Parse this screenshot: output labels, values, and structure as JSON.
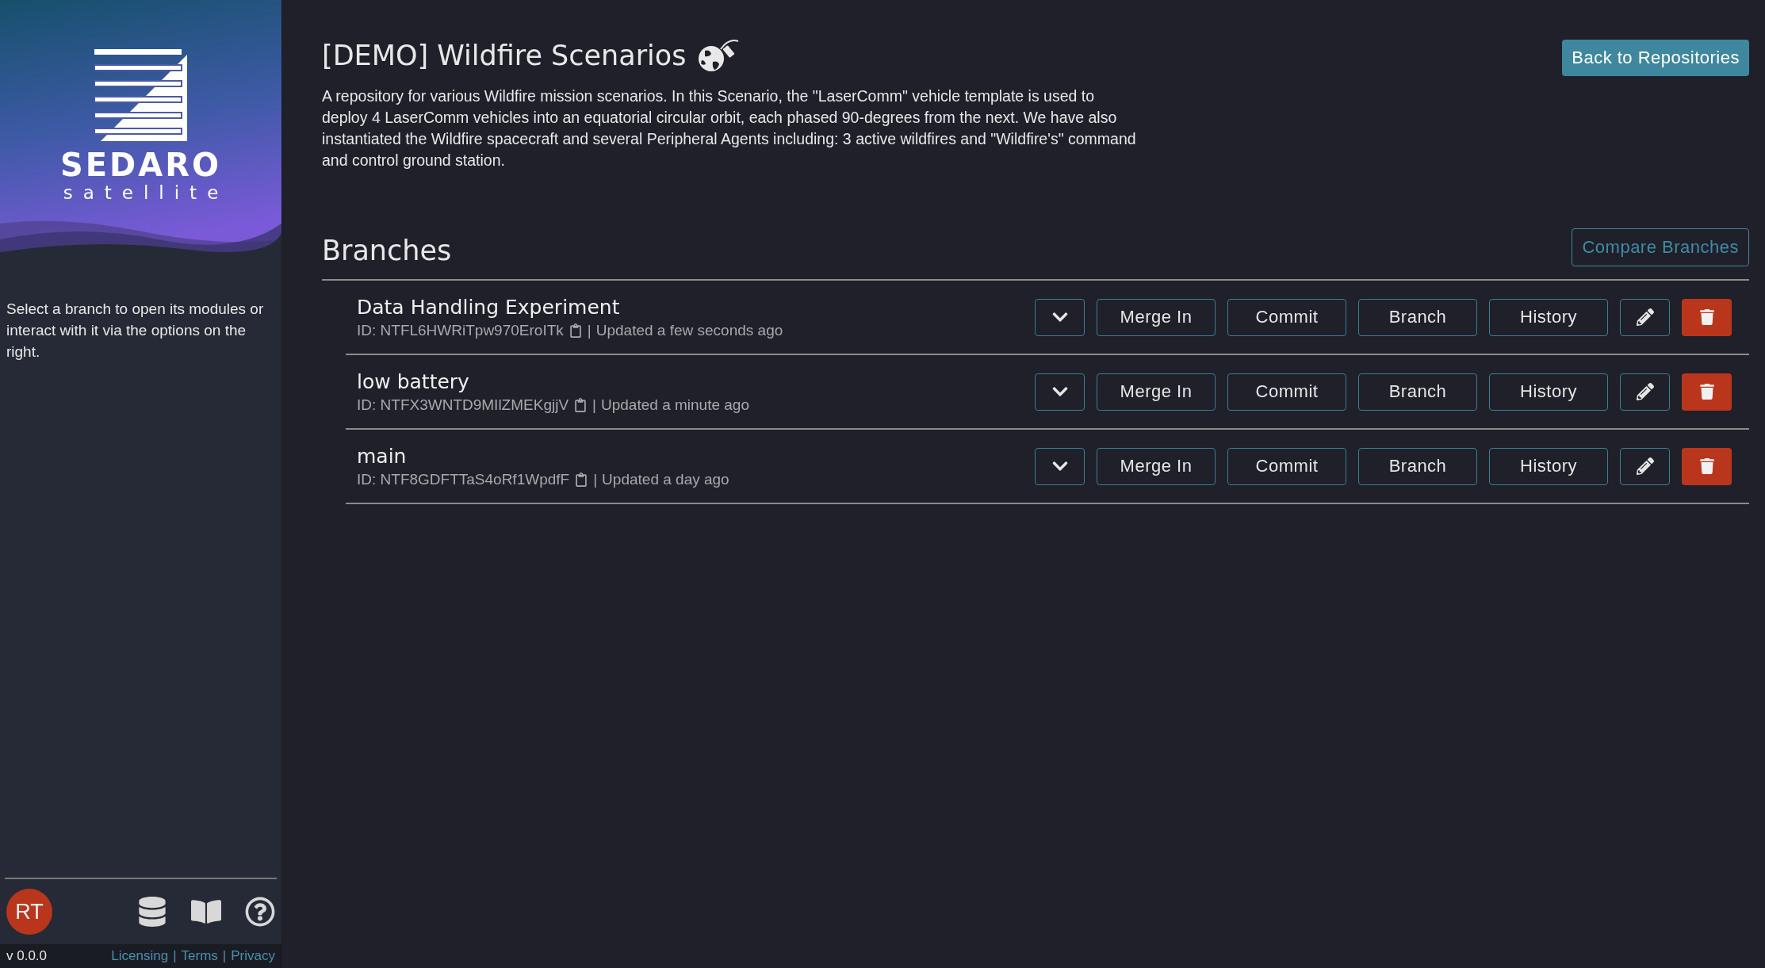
{
  "sidebar": {
    "logo": {
      "wordmark": "SEDARO",
      "tagline": "satellite"
    },
    "help_text": "Select a branch to open its modules or interact with it via the options on the right.",
    "user": {
      "initials": "RT"
    },
    "footer": {
      "version": "v 0.0.0",
      "links": [
        {
          "label": "Licensing"
        },
        {
          "label": "Terms"
        },
        {
          "label": "Privacy"
        }
      ],
      "separators": [
        "|",
        "|"
      ]
    }
  },
  "header": {
    "title": "[DEMO] Wildfire Scenarios",
    "description": "A repository for various Wildfire mission scenarios. In this Scenario, the \"LaserComm\" vehicle template is used to deploy 4 LaserComm vehicles into an equatorial circular orbit, each phased 90-degrees from the next. We have also instantiated the Wildfire spacecraft and several Peripheral Agents including: 3 active wildfires and \"Wildfire's\" command and control ground station.",
    "back_button": "Back to Repositories"
  },
  "branches": {
    "heading": "Branches",
    "compare_button": "Compare Branches",
    "items": [
      {
        "name": "Data Handling Experiment",
        "id": "ID: NTFL6HWRiTpw970EroITk",
        "separator": "|",
        "updated": "Updated a few seconds ago",
        "actions": [
          "Merge In",
          "Commit",
          "Branch",
          "History"
        ]
      },
      {
        "name": "low battery",
        "id": "ID: NTFX3WNTD9MIlZMEKgjjV",
        "separator": "|",
        "updated": "Updated a minute ago",
        "actions": [
          "Merge In",
          "Commit",
          "Branch",
          "History"
        ]
      },
      {
        "name": "main",
        "id": "ID: NTF8GDFTTaS4oRf1WpdfF",
        "separator": "|",
        "updated": "Updated a day ago",
        "actions": [
          "Merge In",
          "Commit",
          "Branch",
          "History"
        ]
      }
    ]
  }
}
